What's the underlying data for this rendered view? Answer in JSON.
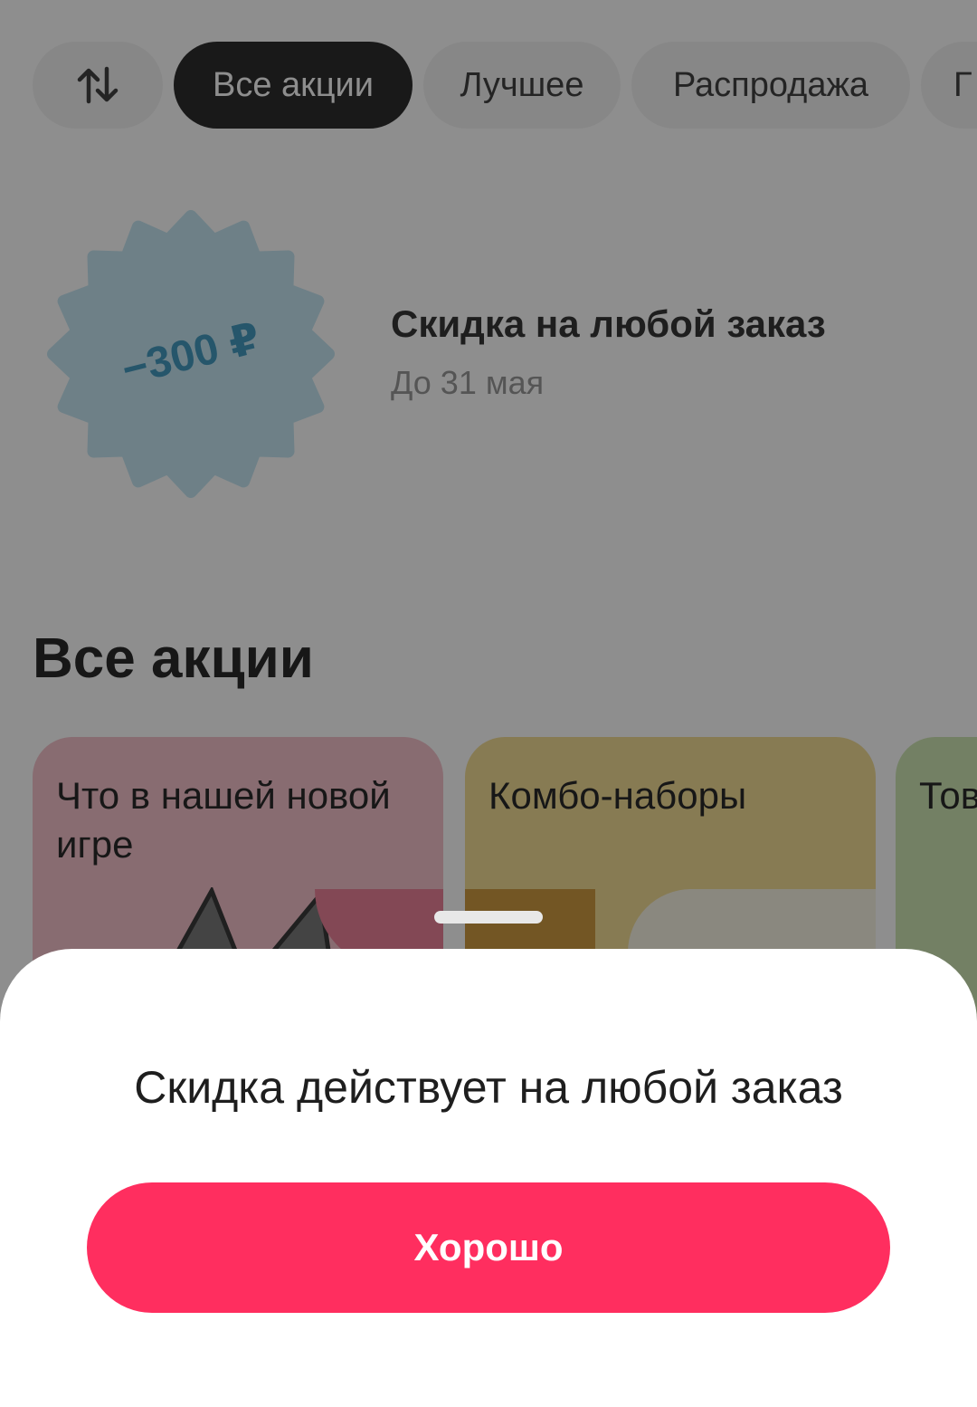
{
  "filters": {
    "sort_icon": "sort-arrows-icon",
    "chips": [
      {
        "label": "Все акции",
        "active": true
      },
      {
        "label": "Лучшее",
        "active": false
      },
      {
        "label": "Распродажа",
        "active": false
      },
      {
        "label": "Г",
        "active": false
      }
    ]
  },
  "promo": {
    "badge_text": "−300 ₽",
    "title": "Скидка на любой заказ",
    "subtitle": "До 31 мая",
    "badge_color": "#bfe3f1"
  },
  "section": {
    "title": "Все акции",
    "cards": [
      {
        "title": "Что в нашей новой игре",
        "color": "#f2bac4"
      },
      {
        "title": "Комбо-наборы",
        "color": "#f1d889"
      },
      {
        "title": "Тов",
        "color": "#c8e3ab"
      }
    ]
  },
  "sheet": {
    "message": "Скидка действует на любой заказ",
    "button_label": "Хорошо",
    "accent_color": "#ff2e5f"
  }
}
